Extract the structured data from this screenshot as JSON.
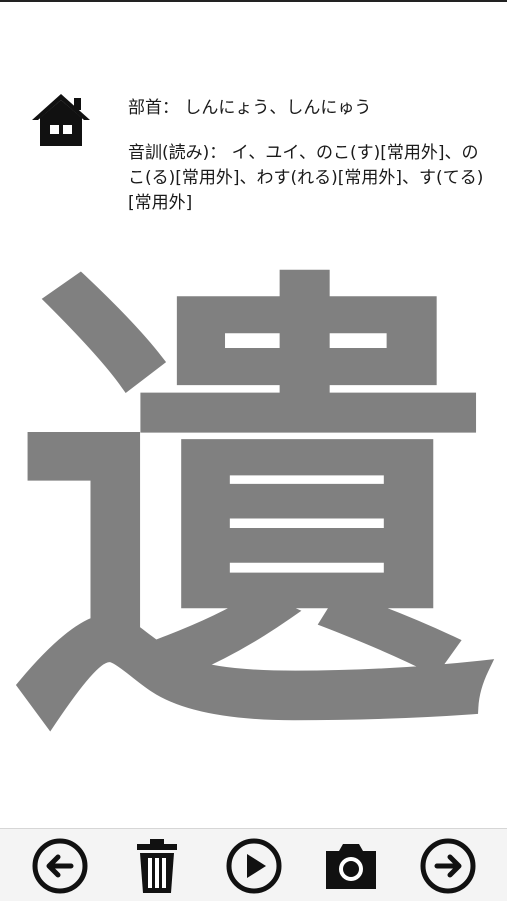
{
  "info": {
    "radical_label": "部首：",
    "radical_value": "しんにょう、しんにゅう",
    "reading_label": "音訓(読み)：",
    "reading_value": "イ、ユイ、のこ(す)[常用外]、のこ(る)[常用外]、わす(れる)[常用外]、す(てる)[常用外]"
  },
  "kanji": {
    "character": "遺",
    "color": "#808080"
  },
  "toolbar": {
    "icons": [
      "arrow-left-circle-icon",
      "trash-icon",
      "play-circle-icon",
      "camera-icon",
      "arrow-right-circle-icon"
    ]
  }
}
